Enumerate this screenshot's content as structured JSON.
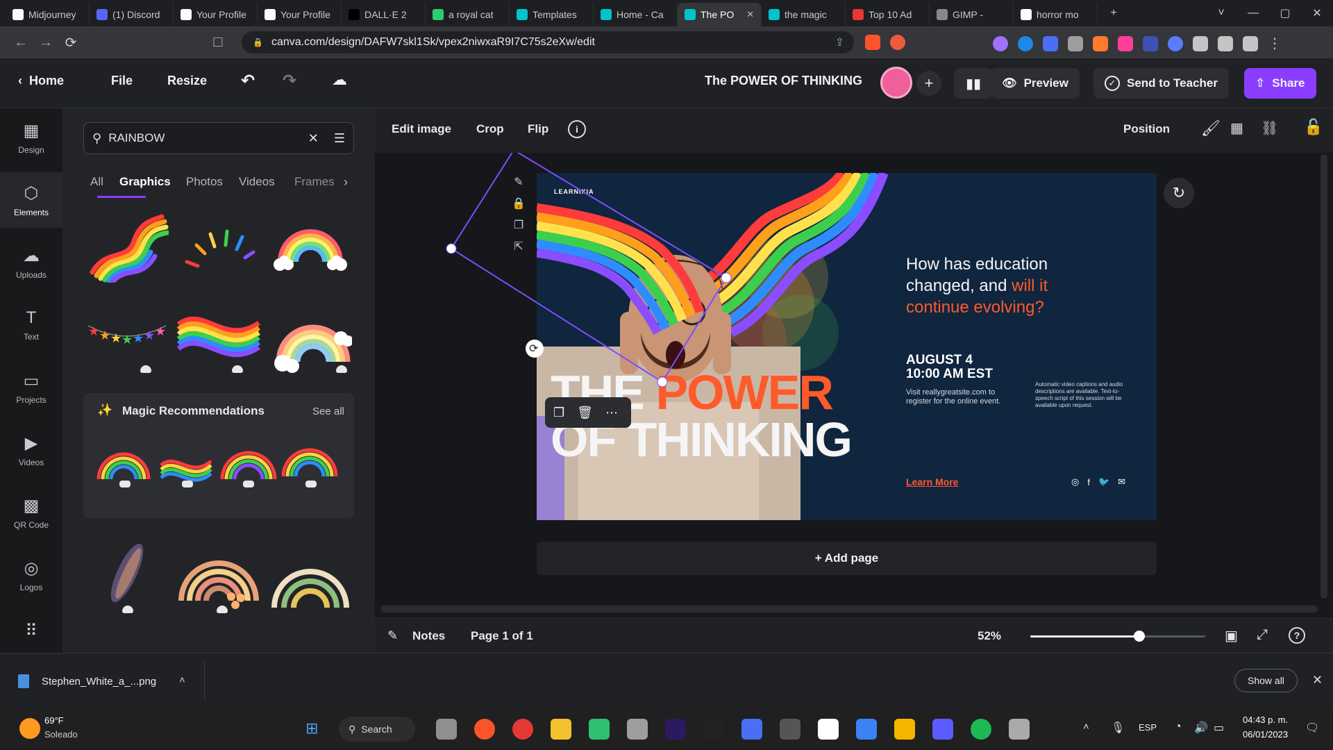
{
  "browser": {
    "tabs": [
      {
        "label": "Midjourney",
        "color": "#ffffff"
      },
      {
        "label": "(1) Discord",
        "color": "#5865f2"
      },
      {
        "label": "Your Profile",
        "color": "#ffffff"
      },
      {
        "label": "Your Profile",
        "color": "#ffffff"
      },
      {
        "label": "DALL·E 2",
        "color": "#000000"
      },
      {
        "label": "a royal cat",
        "color": "#2ecc71"
      },
      {
        "label": "Templates",
        "color": "#00c4cc"
      },
      {
        "label": "Home - Ca",
        "color": "#00c4cc"
      },
      {
        "label": "The PO",
        "color": "#00c4cc"
      },
      {
        "label": "the magic",
        "color": "#00c4cc"
      },
      {
        "label": "Top 10 Ad",
        "color": "#e53935"
      },
      {
        "label": "GIMP -",
        "color": "#888888"
      },
      {
        "label": "horror mo",
        "color": "#ffffff"
      }
    ],
    "url": "canva.com/design/DAFW7skl1Sk/vpex2niwxaR9I7C75s2eXw/edit"
  },
  "canva": {
    "home": "Home",
    "file": "File",
    "resize": "Resize",
    "title": "The POWER OF THINKING",
    "preview": "Preview",
    "send": "Send to Teacher",
    "share": "Share",
    "rail": [
      {
        "label": "Design",
        "icon": "layout-icon"
      },
      {
        "label": "Elements",
        "icon": "shapes-icon"
      },
      {
        "label": "Uploads",
        "icon": "cloud-upload-icon"
      },
      {
        "label": "Text",
        "icon": "text-icon"
      },
      {
        "label": "Projects",
        "icon": "folder-icon"
      },
      {
        "label": "Videos",
        "icon": "video-icon"
      },
      {
        "label": "QR Code",
        "icon": "qr-icon"
      },
      {
        "label": "Logos",
        "icon": "logo-icon"
      }
    ],
    "search": {
      "value": "RAINBOW"
    },
    "panel_tabs": [
      "All",
      "Graphics",
      "Photos",
      "Videos",
      "Frames"
    ],
    "magic_title": "Magic Recommendations",
    "see_all": "See all",
    "toolbar": {
      "edit": "Edit image",
      "crop": "Crop",
      "flip": "Flip",
      "position": "Position"
    },
    "design": {
      "brand": "LEARNIXIA",
      "question_a": "How has education",
      "question_b": "changed, and ",
      "question_highlight": "will it continue evolving?",
      "date": "AUGUST 4",
      "time": "10:00 AM EST",
      "visit": "Visit reallygreatsite.com to register for the online event.",
      "caption_note": "Automatic video captions and audio descriptions are available. Text-to-speech script of this session will be available upon request.",
      "heading_1a": "THE ",
      "heading_1b": "POWER",
      "heading_2": "OF THINKING",
      "learn_more": "Learn More"
    },
    "add_page": "+ Add page",
    "notes": "Notes",
    "page_info": "Page 1 of 1",
    "zoom": "52%",
    "zoom_fraction": 0.52
  },
  "download": {
    "file": "Stephen_White_a_...png",
    "show_all": "Show all"
  },
  "taskbar": {
    "temp": "69°F",
    "weather": "Soleado",
    "search": "Search",
    "lang": "ESP",
    "time": "04:43 p. m.",
    "date": "06/01/2023"
  }
}
